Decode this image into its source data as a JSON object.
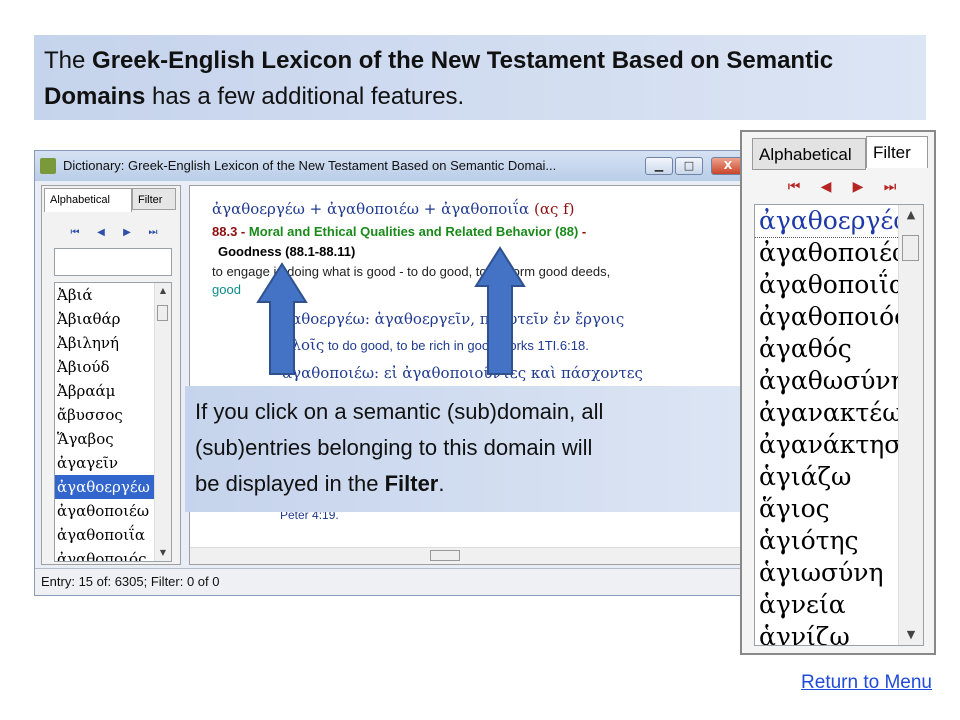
{
  "title": {
    "pre": "The ",
    "bold": "Greek-English Lexicon of the New Testament Based on Semantic Domains",
    "post": " has a few additional features."
  },
  "window": {
    "title": "Dictionary: Greek-English Lexicon of the New Testament Based on Semantic Domai...",
    "minimize": "▁",
    "maximize": "□",
    "close": "X",
    "tabs": [
      "Alphabetical",
      "Filter"
    ],
    "nav": [
      "⏮",
      "◀",
      "▶",
      "⏭"
    ],
    "list": [
      "Ἀβιά",
      "Ἀβιαθάρ",
      "Ἀβιληνή",
      "Ἀβιούδ",
      "Ἀβραάμ",
      "ἄβυσσος",
      "Ἅγαβος",
      "ἀγαγεῖν",
      "ἀγαθοεργέω",
      "ἀγαθοποιέω",
      "ἀγαθοποιΐα",
      "ἀγαθοποιός"
    ],
    "selected_index": 8,
    "entry": {
      "headword": "ἀγαθοεργέω",
      "plus1": " + ",
      "headword2": "ἀγαθοποιέω",
      "plus2": " + ",
      "headword3": "ἀγαθοποιΐα",
      "gram": " (ας f)",
      "domain_num": "88.3",
      "domain_sep": " - ",
      "domain_name": "Moral and Ethical Qualities and Related Behavior (88)",
      "domain_dash": " -",
      "subdomain": "Goodness (88.1-88.11)",
      "definition": "to engage in doing what is good - to do good, to perform good deeds,",
      "definition2": "good",
      "ex1_greek": "ἀγαθοεργέω: ἀγαθοεργεῖν, πλουτεῖν ἐν ἔργοις",
      "ex1_greek2": "καλοῖς",
      "ex1_eng": " to do good, to be rich in good works 1TI.6:18.",
      "ex2_greek": "ἀγαθοποιέω: εἰ ἀγαθοποιοῦντες καὶ πάσχοντες",
      "ex_tail": "Peter 4:19."
    },
    "status": "Entry: 15 of: 6305; Filter: 0 of 0"
  },
  "callout": {
    "line1": "If you click on a semantic (sub)domain, all",
    "line2": "(sub)entries belonging to this domain will",
    "line3_pre": "be displayed in the ",
    "line3_bold": "Filter",
    "line3_post": "."
  },
  "zoom": {
    "tabs": [
      "Alphabetical",
      "Filter"
    ],
    "nav": [
      "⏮",
      "◀",
      "▶",
      "⏭"
    ],
    "list": [
      "ἀγαθοεργέω",
      "ἀγαθοποιέω",
      "ἀγαθοποιΐα",
      "ἀγαθοποιός",
      "ἀγαθός",
      "ἀγαθωσύνη",
      "ἀγανακτέω",
      "ἀγανάκτησις",
      "ἁγιάζω",
      "ἅγιος",
      "ἁγιότης",
      "ἁγιωσύνη",
      "ἁγνεία",
      "ἁγνίζω"
    ]
  },
  "return_link": "Return to Menu",
  "colors": {
    "title_bg": "#c5d3ec",
    "accent_blue": "#3366cc",
    "arrow_blue": "#4472c4",
    "link": "#1f4bd8"
  }
}
